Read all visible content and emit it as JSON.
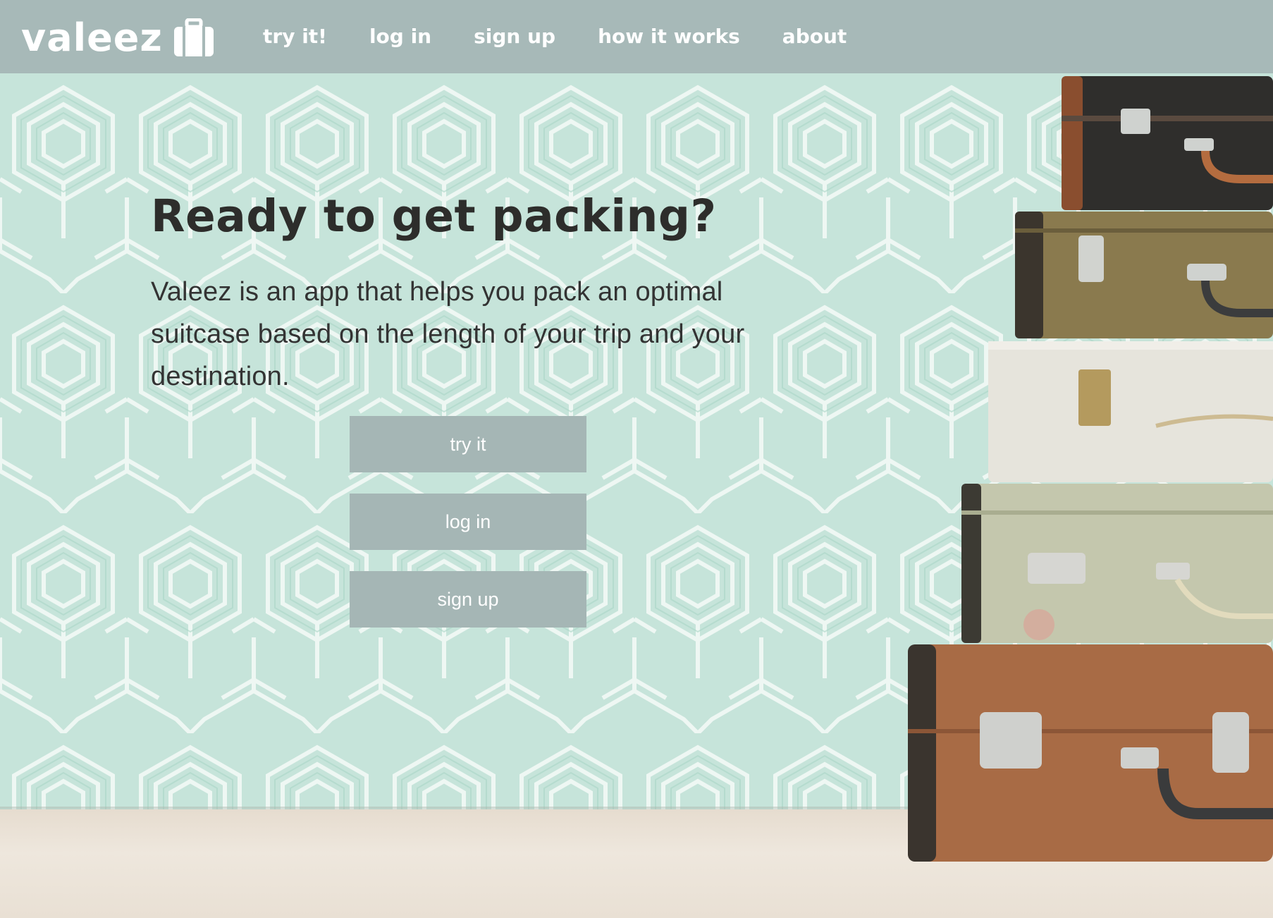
{
  "nav": {
    "brand": "valeez",
    "links": [
      {
        "label": "try it!"
      },
      {
        "label": "log in"
      },
      {
        "label": "sign up"
      },
      {
        "label": "how it works"
      },
      {
        "label": "about"
      }
    ]
  },
  "hero": {
    "headline": "Ready to get packing?",
    "description": "Valeez is an app that helps you pack an optimal suitcase based on the length of your trip and your destination.",
    "buttons": {
      "try_label": "try it",
      "login_label": "log in",
      "signup_label": "sign up"
    }
  },
  "colors": {
    "navbar": "#a7b9b8",
    "button": "#a5b6b5",
    "wallpaper": "#c9e6dc",
    "headline": "#2d2d2b"
  },
  "icons": {
    "brand": "suitcase-icon"
  }
}
